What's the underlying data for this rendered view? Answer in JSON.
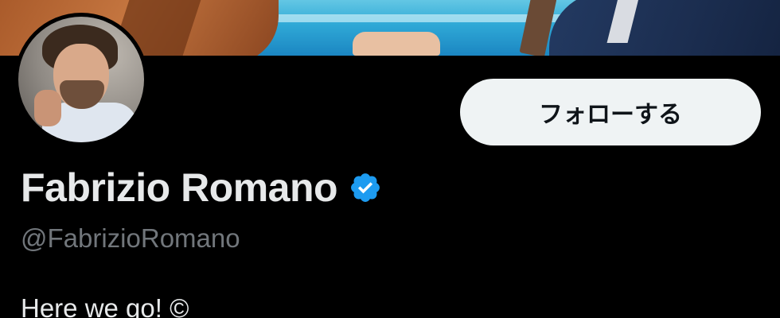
{
  "profile": {
    "display_name": "Fabrizio Romano",
    "verified": true,
    "verified_icon": "verified-badge-icon",
    "handle": "@FabrizioRomano",
    "bio": "Here we go! ©",
    "follow_button_label": "フォローする"
  },
  "colors": {
    "background": "#000000",
    "name_text": "#e7e9ea",
    "handle_text": "#71767b",
    "verified_badge": "#1d9bf0",
    "follow_button_bg": "#eff3f4",
    "follow_button_text": "#0f1419"
  }
}
